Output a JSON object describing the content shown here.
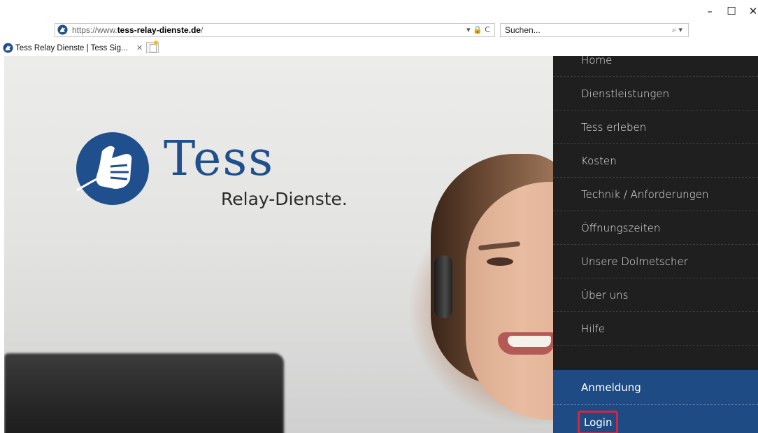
{
  "browser": {
    "window_controls": {
      "minimize": "–",
      "maximize": "☐",
      "close": "✕"
    },
    "address": {
      "proto": "https://www.",
      "host": "tess-relay-dienste.de",
      "path": "/",
      "tools": "▾ 🔒 C"
    },
    "search": {
      "placeholder": "Suchen...",
      "icon": "⌕ ▾"
    },
    "tab": {
      "title": "Tess Relay Dienste | Tess Sig...",
      "close": "✕"
    }
  },
  "logo": {
    "name": "Tess",
    "tagline": "Relay-Dienste."
  },
  "menu": {
    "items": [
      {
        "label": "Home"
      },
      {
        "label": "Dienstleistungen"
      },
      {
        "label": "Tess erleben"
      },
      {
        "label": "Kosten"
      },
      {
        "label": "Technik / Anforderungen"
      },
      {
        "label": "Öffnungszeiten"
      },
      {
        "label": "Unsere Dolmetscher"
      },
      {
        "label": "Über uns"
      },
      {
        "label": "Hilfe"
      }
    ],
    "account": {
      "register": "Anmeldung",
      "login": "Login"
    }
  },
  "colors": {
    "brand_blue": "#1f4f8c",
    "menu_bg": "#1f1f1f",
    "account_bg": "#1f4b85",
    "highlight": "#d8253f"
  }
}
